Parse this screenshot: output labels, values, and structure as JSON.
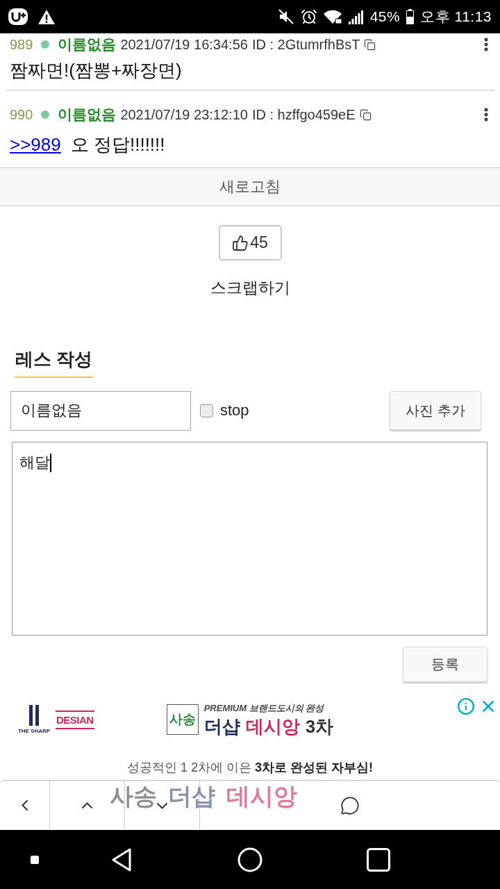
{
  "status_bar": {
    "battery": "45%",
    "time": "오후 11:13"
  },
  "posts": [
    {
      "number": "989",
      "name": "이름없음",
      "date": "2021/07/19 16:34:56",
      "user_id": "ID : 2GtumrfhBsT",
      "text": "짬짜면!(짬뽕+짜장면)"
    },
    {
      "number": "990",
      "name": "이름없음",
      "date": "2021/07/19 23:12:10",
      "user_id": "ID : hzffgo459eE",
      "reply_to": ">>989",
      "text": "오 정답!!!!!!!"
    }
  ],
  "refresh_button": "새로고침",
  "like_button": {
    "count": "45"
  },
  "scrap_link": "스크랩하기",
  "reply_form": {
    "title": "레스 작성",
    "name_field": {
      "value": "이름없음"
    },
    "stop_checkbox": {
      "label": "stop",
      "checked": false
    },
    "photo_button": "사진 추가",
    "body_field": {
      "value": "해달"
    },
    "submit_button": "등록"
  },
  "ad": {
    "brand_logos": [
      {
        "kind": "pillar",
        "text": "THE SHARP"
      },
      {
        "kind": "framed",
        "text": "DESIAN"
      }
    ],
    "badge": "사송",
    "tagline": "PREMIUM 브랜드도시의 완성",
    "title": [
      {
        "text": "더샵",
        "color": "#1f2d5a"
      },
      {
        "text": "데시앙",
        "color": "#d3245a"
      },
      {
        "text": "3차",
        "color": "#333333"
      }
    ],
    "slogan": "성공적인 1 2차에 이은 **3차로 완성된 자부심!**",
    "faded_title": [
      {
        "text": "사송",
        "color": "#8e8e8e"
      },
      {
        "text": "더샵",
        "color": "#8792ae"
      },
      {
        "text": "데시앙",
        "color": "#de7b9a"
      }
    ]
  }
}
